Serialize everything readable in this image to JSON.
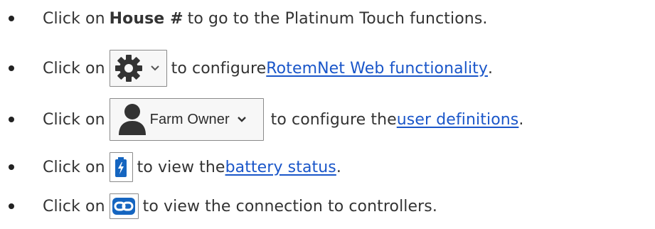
{
  "items": [
    {
      "prefix": "Click on ",
      "bold": "House #",
      "suffix": " to go to the Platinum Touch functions."
    },
    {
      "prefix": "Click on",
      "icon": "gear-icon",
      "middle": "to configure ",
      "link": "RotemNet Web functionality",
      "suffix": "."
    },
    {
      "prefix": "Click on",
      "icon": "user-icon",
      "button_label": "Farm Owner",
      "middle": "to configure the ",
      "link": "user definitions",
      "suffix": "."
    },
    {
      "prefix": "Click on",
      "icon": "battery-icon",
      "middle": "to view the ",
      "link": "battery status",
      "suffix": "."
    },
    {
      "prefix": "Click on",
      "icon": "link-icon",
      "middle": "to view the connection to controllers."
    }
  ],
  "colors": {
    "link": "#1a56c9",
    "text": "#333333",
    "icon": "#333333",
    "accent_blue": "#1565c0"
  }
}
